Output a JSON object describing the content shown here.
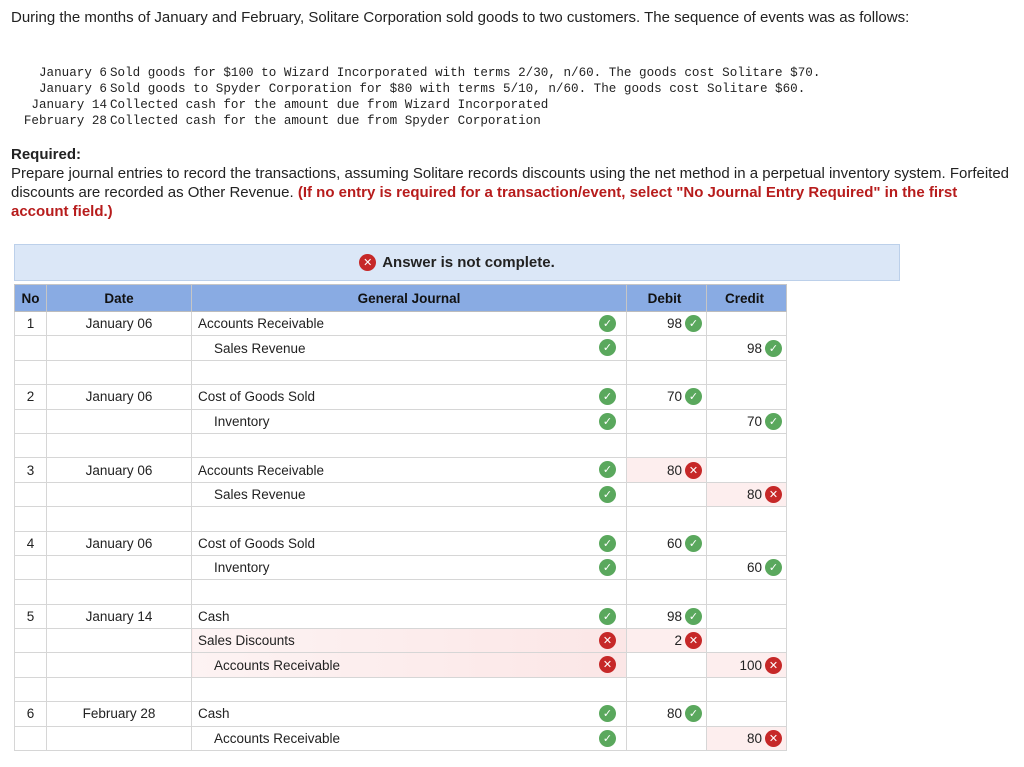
{
  "problem": {
    "intro": "During the months of January and February, Solitare Corporation sold goods to two customers. The sequence of events was as follows:",
    "events": [
      {
        "date": "January 6",
        "text": "Sold goods for $100 to Wizard Incorporated with terms 2/30, n/60. The goods cost Solitare $70."
      },
      {
        "date": "January 6",
        "text": "Sold goods to Spyder Corporation for $80 with terms 5/10, n/60. The goods cost Solitare $60."
      },
      {
        "date": "January 14",
        "text": "Collected cash for the amount due from Wizard Incorporated"
      },
      {
        "date": "February 28",
        "text": "Collected cash for the amount due from Spyder Corporation"
      }
    ],
    "required_title": "Required:",
    "required_text": "Prepare journal entries to record the transactions, assuming Solitare records discounts using the net method in a perpetual inventory system. Forfeited discounts are recorded as Other Revenue. ",
    "required_emphasis": "(If no entry is required for a transaction/event, select \"No Journal Entry Required\" in the first account field.)"
  },
  "banner": {
    "icon": "x-circle-icon",
    "text": "Answer is not complete."
  },
  "journal": {
    "headers": {
      "no": "No",
      "date": "Date",
      "account": "General Journal",
      "debit": "Debit",
      "credit": "Credit"
    },
    "colors": {
      "header_bg": "#89abe3",
      "correct": "#5aa85d",
      "incorrect": "#c62828"
    },
    "entries": [
      {
        "no": "1",
        "date": "January 06",
        "lines": [
          {
            "account": "Accounts Receivable",
            "indent": false,
            "acct_ok": true,
            "debit": "98",
            "debit_ok": true,
            "credit": "",
            "credit_ok": null
          },
          {
            "account": "Sales Revenue",
            "indent": true,
            "acct_ok": true,
            "debit": "",
            "debit_ok": null,
            "credit": "98",
            "credit_ok": true
          }
        ]
      },
      {
        "no": "2",
        "date": "January 06",
        "lines": [
          {
            "account": "Cost of Goods Sold",
            "indent": false,
            "acct_ok": true,
            "debit": "70",
            "debit_ok": true,
            "credit": "",
            "credit_ok": null
          },
          {
            "account": "Inventory",
            "indent": true,
            "acct_ok": true,
            "debit": "",
            "debit_ok": null,
            "credit": "70",
            "credit_ok": true
          }
        ]
      },
      {
        "no": "3",
        "date": "January 06",
        "lines": [
          {
            "account": "Accounts Receivable",
            "indent": false,
            "acct_ok": true,
            "debit": "80",
            "debit_ok": false,
            "credit": "",
            "credit_ok": null
          },
          {
            "account": "Sales Revenue",
            "indent": true,
            "acct_ok": true,
            "debit": "",
            "debit_ok": null,
            "credit": "80",
            "credit_ok": false
          }
        ]
      },
      {
        "no": "4",
        "date": "January 06",
        "lines": [
          {
            "account": "Cost of Goods Sold",
            "indent": false,
            "acct_ok": true,
            "debit": "60",
            "debit_ok": true,
            "credit": "",
            "credit_ok": null
          },
          {
            "account": "Inventory",
            "indent": true,
            "acct_ok": true,
            "debit": "",
            "debit_ok": null,
            "credit": "60",
            "credit_ok": true
          }
        ]
      },
      {
        "no": "5",
        "date": "January 14",
        "lines": [
          {
            "account": "Cash",
            "indent": false,
            "acct_ok": true,
            "debit": "98",
            "debit_ok": true,
            "credit": "",
            "credit_ok": null
          },
          {
            "account": "Sales Discounts",
            "indent": false,
            "acct_ok": false,
            "debit": "2",
            "debit_ok": false,
            "credit": "",
            "credit_ok": null
          },
          {
            "account": "Accounts Receivable",
            "indent": true,
            "acct_ok": false,
            "debit": "",
            "debit_ok": null,
            "credit": "100",
            "credit_ok": false
          }
        ]
      },
      {
        "no": "6",
        "date": "February 28",
        "lines": [
          {
            "account": "Cash",
            "indent": false,
            "acct_ok": true,
            "debit": "80",
            "debit_ok": true,
            "credit": "",
            "credit_ok": null
          },
          {
            "account": "Accounts Receivable",
            "indent": true,
            "acct_ok": true,
            "debit": "",
            "debit_ok": null,
            "credit": "80",
            "credit_ok": false
          }
        ]
      }
    ]
  }
}
